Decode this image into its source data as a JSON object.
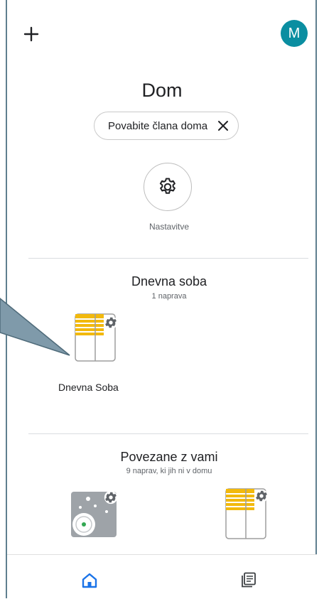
{
  "header": {
    "add_icon": "plus-icon",
    "avatar_letter": "M",
    "avatar_color": "#0a8ea1"
  },
  "home": {
    "title": "Dom",
    "invite_chip_label": "Povabite člana doma",
    "settings_label": "Nastavitve"
  },
  "rooms": [
    {
      "name": "Dnevna soba",
      "device_count": "1 naprava",
      "devices": [
        {
          "label": "Dnevna Soba",
          "icon": "blinds-icon"
        }
      ]
    }
  ],
  "linked": {
    "title": "Povezane z vami",
    "subtitle": "9 naprav, ki jih ni v domu",
    "devices": [
      {
        "label": "",
        "icon": "camera-icon"
      },
      {
        "label": "",
        "icon": "blinds-icon"
      }
    ]
  },
  "bottom_nav": {
    "items": [
      "home-icon",
      "feed-icon"
    ],
    "active_color": "#1a73e8"
  }
}
